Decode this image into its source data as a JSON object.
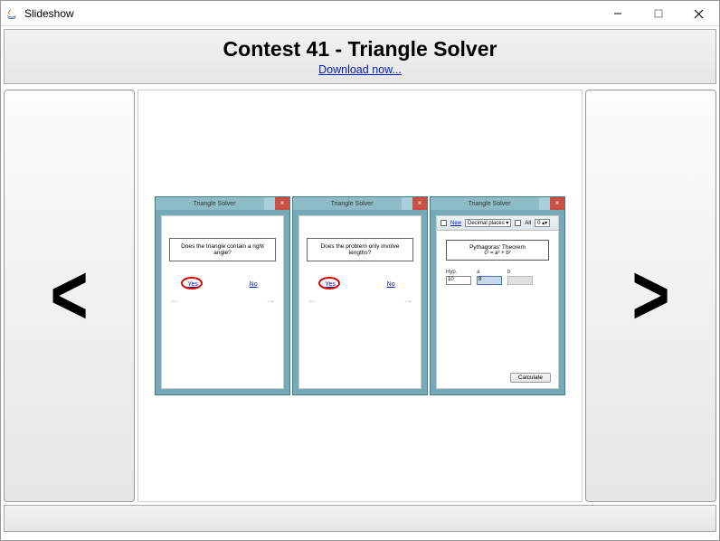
{
  "window": {
    "title": "Slideshow"
  },
  "header": {
    "title": "Contest 41 - Triangle Solver",
    "download_link": "Download now..."
  },
  "nav": {
    "prev": "<",
    "next": ">"
  },
  "slide": {
    "panels": [
      {
        "win_title": "Triangle Solver",
        "question": "Does the triangle contain a right angle?",
        "yes": "Yes",
        "no": "No"
      },
      {
        "win_title": "Triangle Solver",
        "question": "Does the problem only involve lengths?",
        "yes": "Yes",
        "no": "No"
      },
      {
        "win_title": "Triangle Solver",
        "toolbar": {
          "new": "New",
          "decimals_label": "Decimal places",
          "all": "All",
          "spin": "0"
        },
        "theorem_title": "Pythagoras' Theorem",
        "theorem_formula": "c² = a² + b²",
        "hyp_label": "Hyp.",
        "a_label": "a",
        "b_label": "b",
        "hyp_value": "10",
        "a_value": "8",
        "b_value": "",
        "calculate": "Calculate"
      }
    ]
  }
}
